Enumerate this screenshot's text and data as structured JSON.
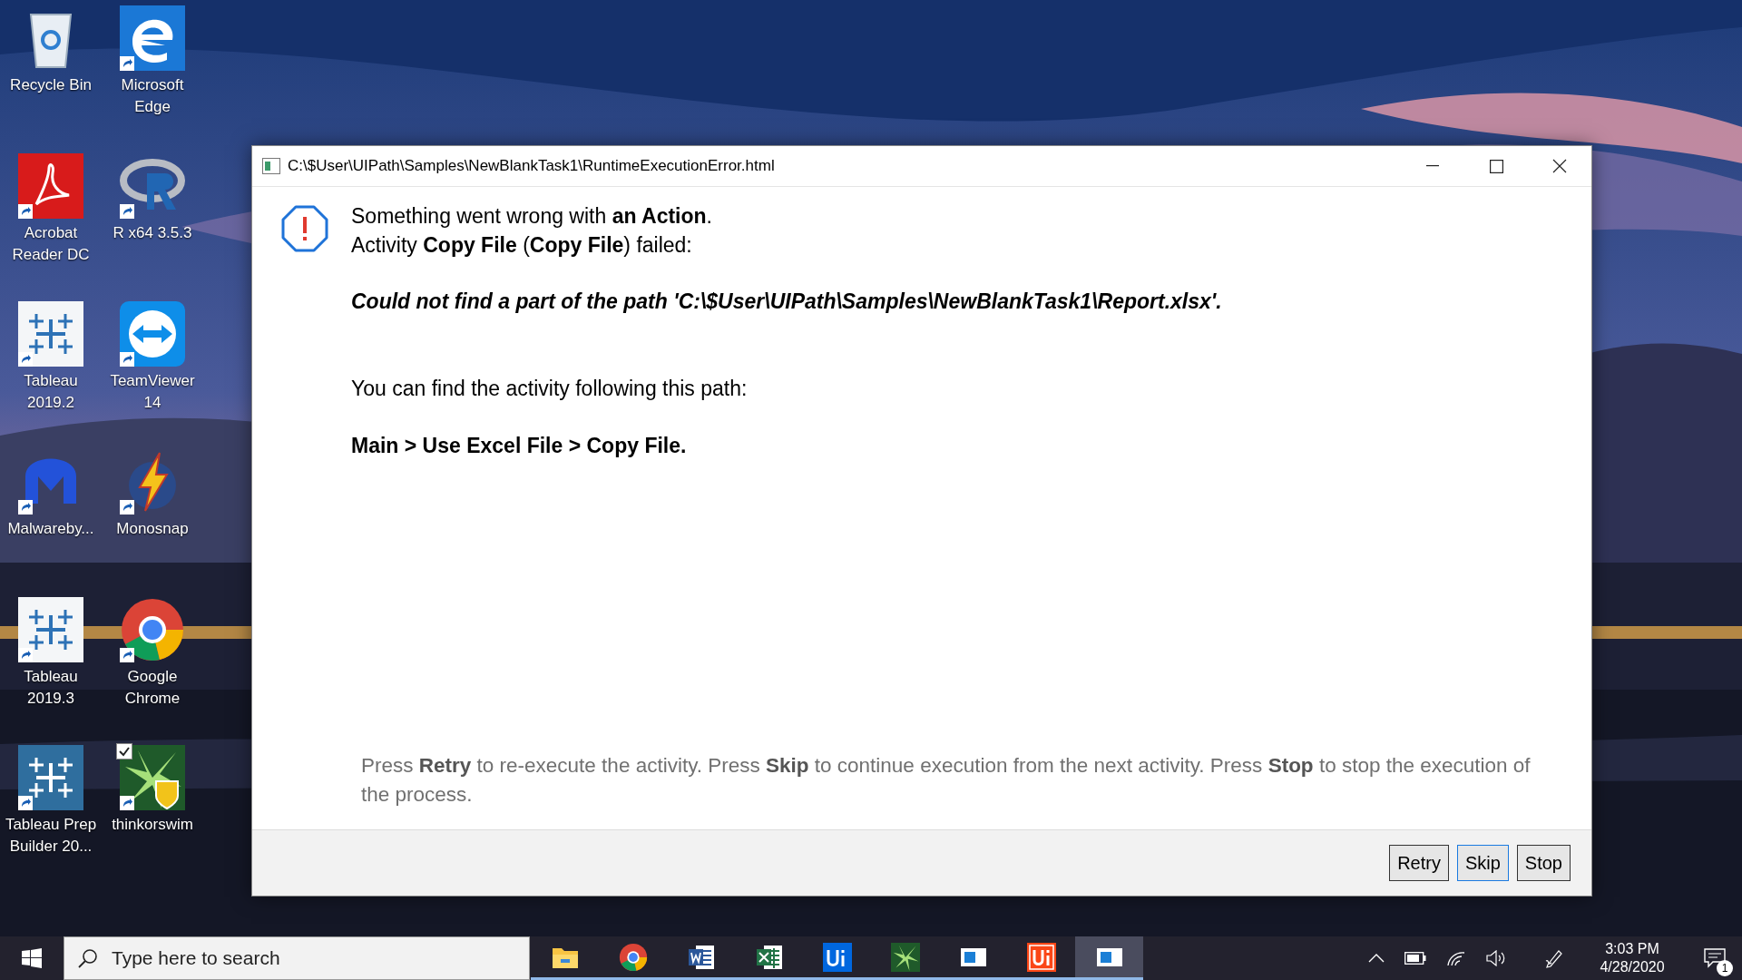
{
  "desktop_icons": [
    {
      "label": "Recycle Bin",
      "kind": "recycle",
      "shortcut": false,
      "checked": false
    },
    {
      "label": "Microsoft Edge",
      "kind": "edge",
      "shortcut": true,
      "checked": false
    },
    {
      "label": "Acrobat Reader DC",
      "kind": "acrobat",
      "shortcut": true,
      "checked": false
    },
    {
      "label": "R x64 3.5.3",
      "kind": "r",
      "shortcut": true,
      "checked": false
    },
    {
      "label": "Tableau 2019.2",
      "kind": "tableau",
      "shortcut": true,
      "checked": false
    },
    {
      "label": "TeamViewer 14",
      "kind": "teamviewer",
      "shortcut": true,
      "checked": false
    },
    {
      "label": "Malwareby...",
      "kind": "malwarebytes",
      "shortcut": true,
      "checked": false
    },
    {
      "label": "Monosnap",
      "kind": "monosnap",
      "shortcut": true,
      "checked": false
    },
    {
      "label": "Tableau 2019.3",
      "kind": "tableau",
      "shortcut": true,
      "checked": false
    },
    {
      "label": "Google Chrome",
      "kind": "chrome",
      "shortcut": true,
      "checked": false
    },
    {
      "label": "Tableau Prep Builder 20...",
      "kind": "tableau-prep",
      "shortcut": true,
      "checked": false
    },
    {
      "label": "thinkorswim",
      "kind": "thinkorswim",
      "shortcut": true,
      "checked": true
    }
  ],
  "window": {
    "title": "C:\\$User\\UIPath\\Samples\\NewBlankTask1\\RuntimeExecutionError.html",
    "message_lines": [
      "Something went wrong with **an Action**.",
      "Activity **Copy File** (**Copy File**) failed:"
    ],
    "error": "Could not find a part of the path 'C:\\$User\\UIPath\\Samples\\NewBlankTask1\\Report.xlsx'.",
    "location_intro": "You can find the activity following this path:",
    "location": "Main > Use Excel File > Copy File.",
    "help": "Press **Retry** to re-execute the activity. Press **Skip** to continue execution from the next activity. Press **Stop** to stop the execution of the process.",
    "buttons": [
      {
        "label": "Retry",
        "selected": false
      },
      {
        "label": "Skip",
        "selected": true
      },
      {
        "label": "Stop",
        "selected": false
      }
    ]
  },
  "taskbar": {
    "search": {
      "placeholder": "Type here to search"
    },
    "apps": [
      {
        "kind": "explorer",
        "running": true,
        "selected": false
      },
      {
        "kind": "chrome",
        "running": true,
        "selected": false
      },
      {
        "kind": "word",
        "running": true,
        "selected": false
      },
      {
        "kind": "excel",
        "running": true,
        "selected": false
      },
      {
        "kind": "uipath",
        "running": true,
        "selected": false
      },
      {
        "kind": "thinkorswim",
        "running": true,
        "selected": false
      },
      {
        "kind": "window",
        "running": true,
        "selected": false
      },
      {
        "kind": "uipath-studio",
        "running": true,
        "selected": false
      },
      {
        "kind": "window",
        "running": true,
        "selected": true
      }
    ],
    "time": "3:03 PM",
    "date": "4/28/2020",
    "notifications": "1"
  }
}
